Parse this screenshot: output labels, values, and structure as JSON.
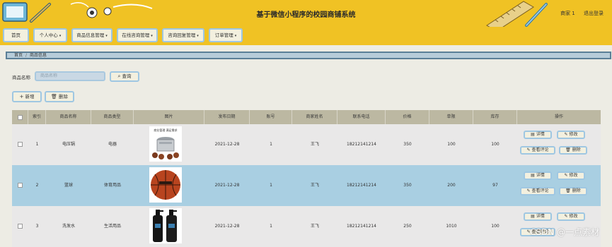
{
  "header": {
    "title": "基于微信小程序的校园商铺系统",
    "user": "商家 1",
    "logout": "退出登录"
  },
  "nav": [
    {
      "label": "首页",
      "dropdown": false
    },
    {
      "label": "个人中心",
      "dropdown": true
    },
    {
      "label": "商品信息管理",
      "dropdown": true
    },
    {
      "label": "在线咨询管理",
      "dropdown": true
    },
    {
      "label": "咨询回复管理",
      "dropdown": true
    },
    {
      "label": "订单管理",
      "dropdown": true
    }
  ],
  "breadcrumb": {
    "home": "首页",
    "separator": "/",
    "current": "商品信息"
  },
  "search": {
    "label": "商品名称",
    "placeholder": "商品名称",
    "button": "查询"
  },
  "toolbar": {
    "add": "新增",
    "delete": "删除"
  },
  "table": {
    "columns": [
      "索引",
      "商品名称",
      "商品类型",
      "图片",
      "发布日期",
      "账号",
      "商家姓名",
      "联系电话",
      "价格",
      "单限",
      "库存",
      "操作"
    ],
    "rows": [
      {
        "index": "1",
        "name": "电压锅",
        "type": "电器",
        "image": "pressure-cooker-image",
        "date": "2021-12-28",
        "account": "1",
        "merchant": "王飞",
        "phone": "18212141214",
        "price": "350",
        "limit": "100",
        "stock": "100"
      },
      {
        "index": "2",
        "name": "篮球",
        "type": "体育用品",
        "image": "basketball-image",
        "date": "2021-12-28",
        "account": "1",
        "merchant": "王飞",
        "phone": "18212141214",
        "price": "350",
        "limit": "200",
        "stock": "97"
      },
      {
        "index": "3",
        "name": "洗发水",
        "type": "生活用品",
        "image": "shampoo-image",
        "date": "2021-12-28",
        "account": "1",
        "merchant": "王飞",
        "phone": "18212141214",
        "price": "250",
        "limit": "1010",
        "stock": "100"
      }
    ],
    "actions": {
      "detail": "详情",
      "edit": "修改",
      "comments": "查看评论",
      "delete": "删除"
    },
    "cooker_banner": "商业管理 满足需求"
  },
  "watermark": "CSDN @一点素材",
  "colors": {
    "header": "#f0c224",
    "table_header": "#bcb8a2",
    "row_highlight": "#a9cfe2",
    "button_border": "#9fc7e2"
  }
}
